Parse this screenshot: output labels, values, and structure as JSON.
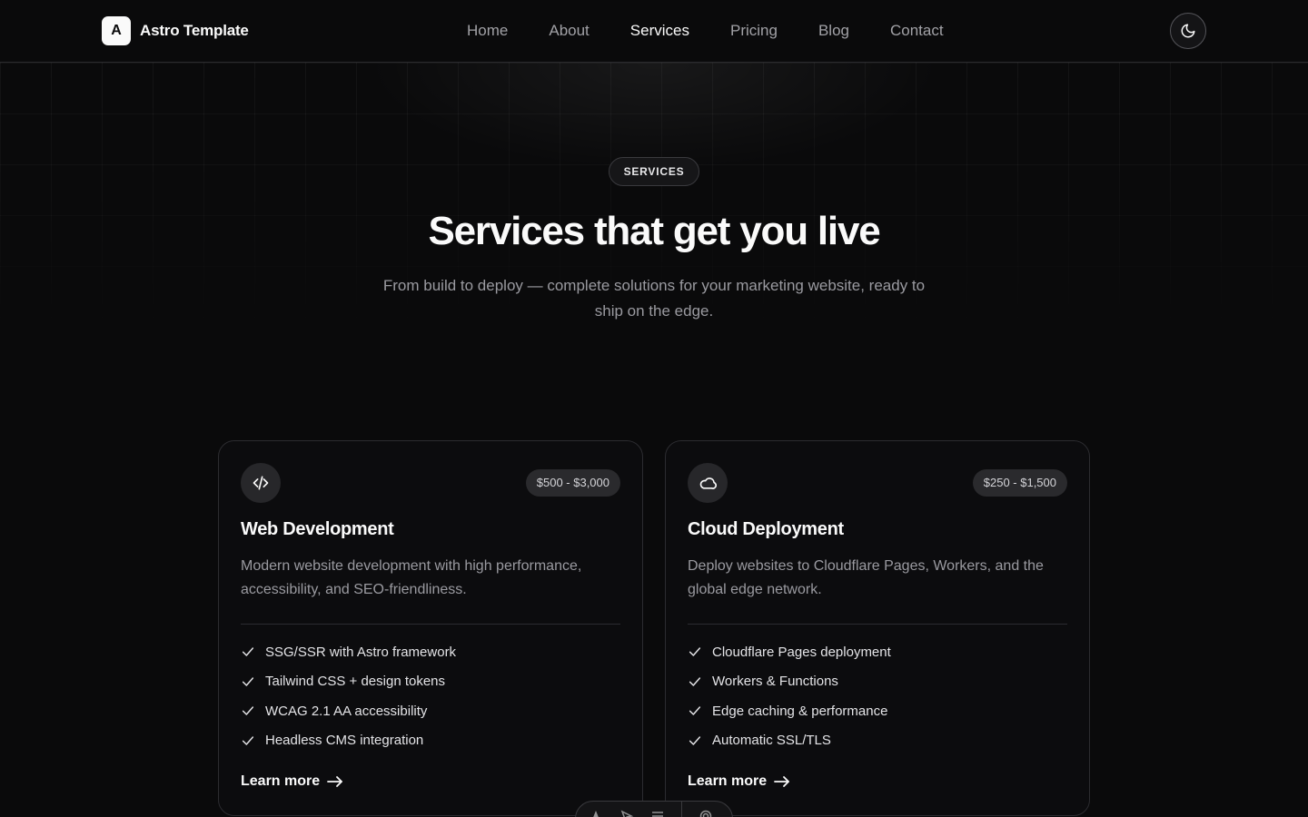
{
  "brand": {
    "mark": "A",
    "name": "Astro Template"
  },
  "nav": {
    "items": [
      {
        "label": "Home"
      },
      {
        "label": "About"
      },
      {
        "label": "Services",
        "active": true
      },
      {
        "label": "Pricing"
      },
      {
        "label": "Blog"
      },
      {
        "label": "Contact"
      }
    ],
    "theme_toggle_icon": "moon-icon"
  },
  "hero": {
    "eyebrow": "SERVICES",
    "title": "Services that get you live",
    "subtitle": "From build to deploy — complete solutions for your marketing website, ready to ship on the edge."
  },
  "services": [
    {
      "icon": "code-icon",
      "price": "$500 - $3,000",
      "title": "Web Development",
      "description": "Modern website development with high performance, accessibility, and SEO-friendliness.",
      "features": [
        "SSG/SSR with Astro framework",
        "Tailwind CSS + design tokens",
        "WCAG 2.1 AA accessibility",
        "Headless CMS integration"
      ],
      "cta": "Learn more"
    },
    {
      "icon": "cloud-icon",
      "price": "$250 - $1,500",
      "title": "Cloud Deployment",
      "description": "Deploy websites to Cloudflare Pages, Workers, and the global edge network.",
      "features": [
        "Cloudflare Pages deployment",
        "Workers & Functions",
        "Edge caching & performance",
        "Automatic SSL/TLS"
      ],
      "cta": "Learn more"
    }
  ],
  "dev_toolbar": {
    "icons": [
      "astro-icon",
      "inspect-icon",
      "menu-icon",
      "settings-icon"
    ]
  },
  "colors": {
    "background": "#0a0a0b",
    "text": "#fafafa",
    "muted": "#9a9aa0",
    "border": "#2c2c30"
  }
}
